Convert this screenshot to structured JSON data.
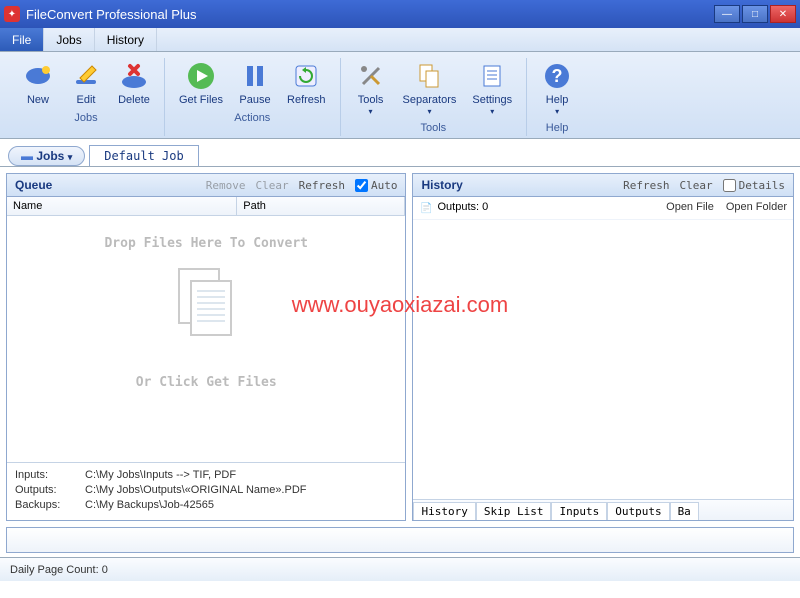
{
  "window": {
    "title": "FileConvert Professional Plus"
  },
  "menu": {
    "file": "File",
    "jobs": "Jobs",
    "history": "History"
  },
  "ribbon": {
    "groups": {
      "jobs": {
        "label": "Jobs",
        "new": "New",
        "edit": "Edit",
        "delete": "Delete"
      },
      "actions": {
        "label": "Actions",
        "getfiles": "Get Files",
        "pause": "Pause",
        "refresh": "Refresh"
      },
      "tools": {
        "label": "Tools",
        "tools": "Tools",
        "separators": "Separators",
        "settings": "Settings"
      },
      "help": {
        "label": "Help",
        "help": "Help"
      }
    }
  },
  "tabs": {
    "jobs_pill": "Jobs",
    "default_job": "Default Job"
  },
  "queue": {
    "title": "Queue",
    "actions": {
      "remove": "Remove",
      "clear": "Clear",
      "refresh": "Refresh",
      "auto": "Auto"
    },
    "columns": {
      "name": "Name",
      "path": "Path"
    },
    "drop_hint": "Drop Files Here To Convert",
    "click_hint": "Or Click Get Files",
    "paths": {
      "inputs_label": "Inputs:",
      "inputs_value": "C:\\My Jobs\\Inputs  --> TIF, PDF",
      "outputs_label": "Outputs:",
      "outputs_value": "C:\\My Jobs\\Outputs\\«ORIGINAL Name».PDF",
      "backups_label": "Backups:",
      "backups_value": "C:\\My Backups\\Job-42565"
    }
  },
  "history": {
    "title": "History",
    "actions": {
      "refresh": "Refresh",
      "clear": "Clear",
      "details": "Details"
    },
    "outputs_label": "Outputs: 0",
    "open_file": "Open File",
    "open_folder": "Open Folder",
    "tabs": [
      "History",
      "Skip List",
      "Inputs",
      "Outputs",
      "Ba"
    ]
  },
  "status": {
    "daily_page_count": "Daily Page Count: 0"
  },
  "watermark": "www.ouyaoxiazai.com",
  "colors": {
    "accent": "#2d54b8",
    "ribbon_bg": "#d5e3f5",
    "border": "#8fa8cf"
  }
}
